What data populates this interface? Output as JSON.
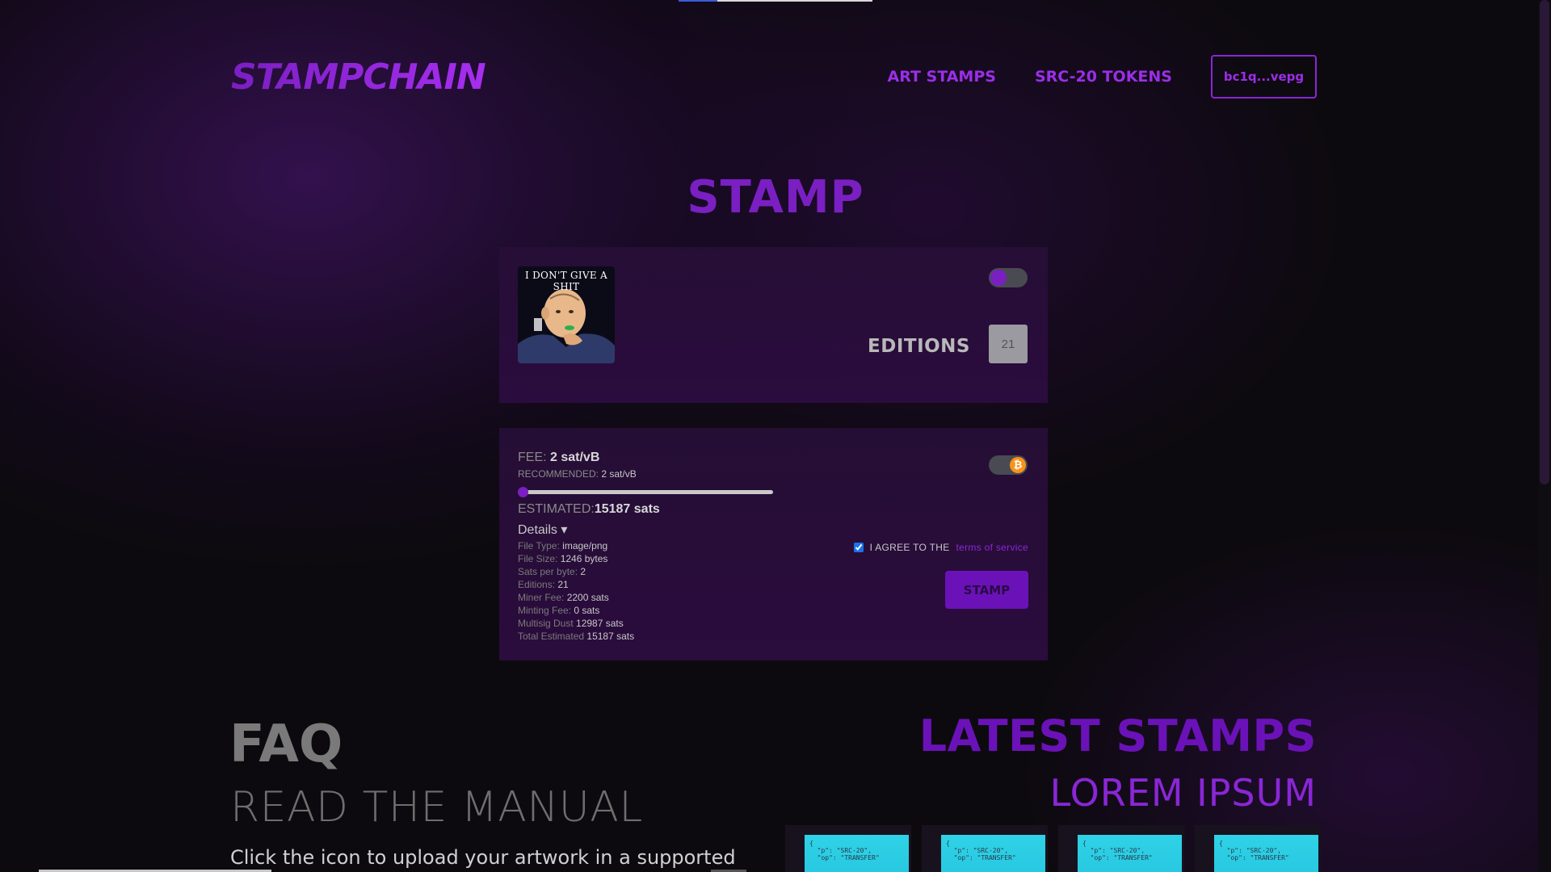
{
  "header": {
    "logo": "STAMPCHAIN",
    "nav": [
      {
        "label": "ART STAMPS"
      },
      {
        "label": "SRC-20 TOKENS"
      }
    ],
    "wallet": "bc1q...vepg"
  },
  "page": {
    "title": "STAMP"
  },
  "upload": {
    "image_caption": "I DON'T GIVE A SHIT",
    "editions_label": "EDITIONS",
    "editions_value": "21"
  },
  "fee": {
    "fee_label": "FEE:",
    "fee_value": "2 sat/vB",
    "recommended_label": "RECOMMENDED:",
    "recommended_value": "2 sat/vB",
    "slider_level": 0.0,
    "estimated_label": "ESTIMATED:",
    "estimated_value": "15187 sats",
    "details_label": "Details ▾",
    "details": [
      {
        "label": "File Type:",
        "value": "image/png"
      },
      {
        "label": "File Size:",
        "value": "1246 bytes"
      },
      {
        "label": "Sats per byte:",
        "value": "2"
      },
      {
        "label": "Editions:",
        "value": "21"
      },
      {
        "label": "Miner Fee:",
        "value": "2200 sats"
      },
      {
        "label": "Minting Fee:",
        "value": "0 sats"
      },
      {
        "label": "Multisig Dust",
        "value": "12987 sats"
      },
      {
        "label": "Total Estimated",
        "value": "15187 sats"
      }
    ],
    "agree_text": "I AGREE TO THE",
    "terms_link": "terms of service",
    "agree_checked": true,
    "btc_icon": "bitcoin-icon",
    "stamp_button": "STAMP"
  },
  "faq": {
    "title": "FAQ",
    "subtitle": "READ THE MANUAL",
    "text": "Click the icon to upload your artwork in a supported"
  },
  "latest": {
    "title": "LATEST STAMPS",
    "subtitle": "LOREM IPSUM",
    "cards": [
      {
        "snippet": "{\n  \"p\": \"SRC-20\",\n  \"op\": \"TRANSFER\""
      },
      {
        "snippet": "{\n  \"p\": \"SRC-20\",\n  \"op\": \"TRANSFER\""
      },
      {
        "snippet": "{\n  \"p\": \"SRC-20\",\n  \"op\": \"TRANSFER\""
      },
      {
        "snippet": "{\n  \"p\": \"SRC-20\",\n  \"op\": \"TRANSFER\""
      }
    ]
  },
  "colors": {
    "accent": "#7a1fc2",
    "bitcoin": "#f7931a"
  }
}
